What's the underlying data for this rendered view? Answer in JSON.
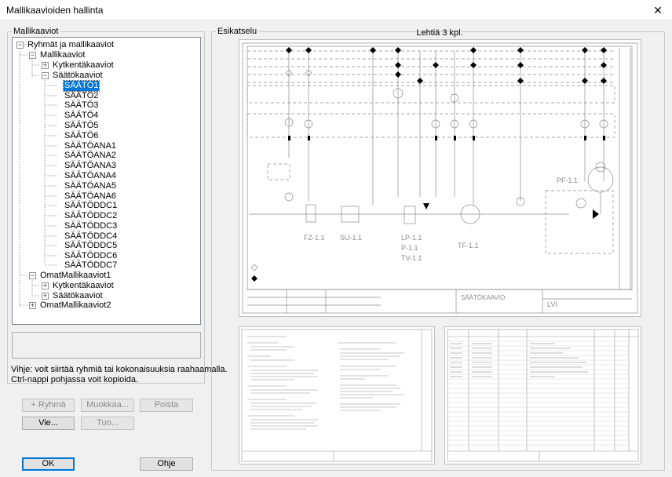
{
  "window": {
    "title": "Mallikaavioiden hallinta",
    "close_glyph": "✕"
  },
  "templates_group": {
    "legend": "Mallikaaviot"
  },
  "tree": {
    "root": "Ryhmät ja mallikaaviot",
    "mallikaaviot": "Mallikaaviot",
    "kytkentakaaviot": "Kytkentäkaaviot",
    "saatokaaviot": "Säätökaaviot",
    "items": [
      "SÄÄTÖ1",
      "SÄÄTÖ2",
      "SÄÄTÖ3",
      "SÄÄTÖ4",
      "SÄÄTÖ5",
      "SÄÄTÖ6",
      "SÄÄTÖANA1",
      "SÄÄTÖANA2",
      "SÄÄTÖANA3",
      "SÄÄTÖANA4",
      "SÄÄTÖANA5",
      "SÄÄTÖANA6",
      "SÄÄTÖDDC1",
      "SÄÄTÖDDC2",
      "SÄÄTÖDDC3",
      "SÄÄTÖDDC4",
      "SÄÄTÖDDC5",
      "SÄÄTÖDDC6",
      "SÄÄTÖDDC7"
    ],
    "selected": "SÄÄTÖ1",
    "omat1": "OmatMallikaaviot1",
    "omat1_kytkenta": "Kytkentäkaaviot",
    "omat1_saato": "Säätökaaviot",
    "omat2": "OmatMallikaaviot2",
    "expand_glyph": "+",
    "collapse_glyph": "−"
  },
  "hint": {
    "line1": "Vihje: voit siirtää ryhmiä tai kokonaisuuksia raahaamalla.",
    "line2": "Ctrl-nappi pohjassa voit kopioida."
  },
  "buttons": {
    "add_group": "+ Ryhmä",
    "edit": "Muokkaa...",
    "delete": "Poista",
    "export": "Vie...",
    "import": "Tuo...",
    "ok": "OK",
    "help": "Ohje"
  },
  "preview": {
    "legend": "Esikatselu",
    "sheets_count": "Lehtiä 3 kpl.",
    "labels": {
      "fz": "FZ-1.1",
      "su": "SU-1.1",
      "lp": "LP-1.1",
      "p": "P-1.1",
      "tv": "TV-1.1",
      "tf": "TF-1.1",
      "pf": "PF-1.1",
      "title": "SÄÄTÖKAAVIO",
      "lvi": "LVI"
    }
  }
}
